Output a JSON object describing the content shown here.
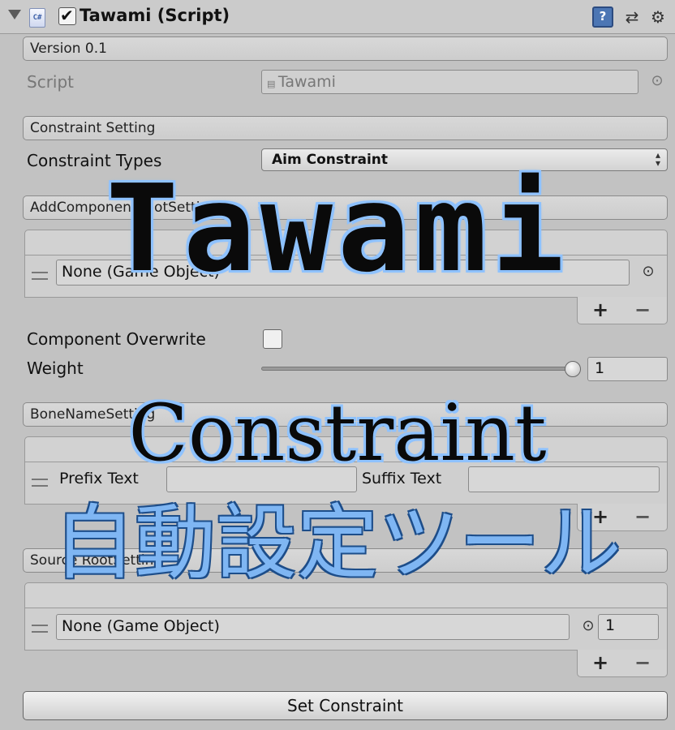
{
  "header": {
    "title": "Tawami (Script)",
    "enabled": true,
    "icons": [
      "foldout-arrow",
      "csharp-script-icon",
      "help-icon",
      "preset-icon",
      "gear-icon"
    ]
  },
  "version_label": "Version 0.1",
  "script": {
    "label": "Script",
    "value": "Tawami"
  },
  "constraint_setting": {
    "header": "Constraint Setting",
    "types_label": "Constraint Types",
    "types_value": "Aim Constraint"
  },
  "addcomponent_root": {
    "header": "AddComponentRootSetting",
    "item_value": "None (Game Object)"
  },
  "component_overwrite": {
    "label": "Component Overwrite",
    "checked": false
  },
  "weight": {
    "label": "Weight",
    "value": "1",
    "fraction": 1.0
  },
  "bone_name": {
    "header": "BoneNameSetting",
    "prefix_label": "Prefix Text",
    "prefix_value": "",
    "suffix_label": "Suffix Text",
    "suffix_value": ""
  },
  "source_root": {
    "header": "Source RootSetting",
    "item_value": "None (Game Object)",
    "item_weight": "1"
  },
  "list_buttons": {
    "plus": "+",
    "minus": "−"
  },
  "set_constraint_button": "Set Constraint",
  "overlay": {
    "title": "Tawami",
    "subtitle1": "Constraint",
    "subtitle2": "自動設定ツール"
  }
}
